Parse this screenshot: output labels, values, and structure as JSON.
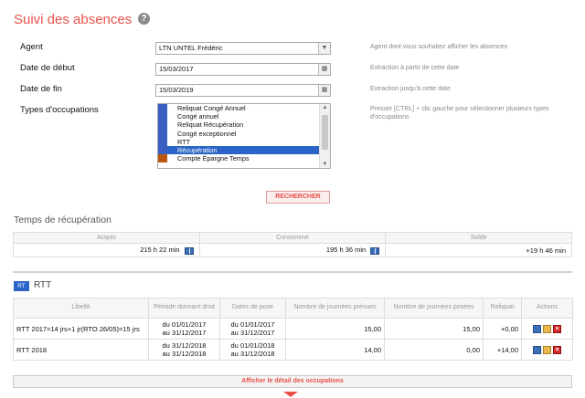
{
  "page": {
    "title": "Suivi des absences"
  },
  "form": {
    "agent": {
      "label": "Agent",
      "value": "LTN UNTEL Frédéric",
      "hint": "Agent dont vous souhaitez afficher les absences"
    },
    "start_date": {
      "label": "Date de début",
      "value": "15/03/2017",
      "hint": "Extraction à partir de cette date"
    },
    "end_date": {
      "label": "Date de fin",
      "value": "15/03/2019",
      "hint": "Extraction jusqu'à cette date"
    },
    "types": {
      "label": "Types d'occupations",
      "hint": "Presser [CTRL] + clic gauche pour sélectionner plusieurs types d'occupations",
      "options": [
        {
          "label": "Reliquat Congé Annuel",
          "color": "#3a5fc0",
          "selected": false
        },
        {
          "label": "Congé annuel",
          "color": "#3a5fc0",
          "selected": false
        },
        {
          "label": "Reliquat Récupération",
          "color": "#3a5fc0",
          "selected": false
        },
        {
          "label": "Congé exceptionnel",
          "color": "#3a5fc0",
          "selected": false
        },
        {
          "label": "RTT",
          "color": "#3a5fc0",
          "selected": false
        },
        {
          "label": "Récupération",
          "color": "#3a5fc0",
          "selected": true
        },
        {
          "label": "Compte Épargne Temps",
          "color": "#b8560e",
          "selected": false
        }
      ]
    },
    "search_label": "RECHERCHER"
  },
  "recup": {
    "title": "Temps de récupération",
    "headers": [
      "Acquis",
      "Consommé",
      "Solde"
    ],
    "values": [
      "215 h 22 min",
      "195 h 36 min",
      "+19 h 46 min"
    ]
  },
  "rtt": {
    "badge": "RT",
    "title": "RTT",
    "headers": [
      "Libellé",
      "Période donnant droit",
      "Dates de pose",
      "Nombre de journées prévues",
      "Nombre de journées posées",
      "Reliquat",
      "Actions"
    ],
    "rows": [
      {
        "libelle": "RTT 2017=14 jrs+1 jr(RTO 26/05)=15 jrs",
        "periode_du": "du 01/01/2017",
        "periode_au": "au 31/12/2017",
        "pose_du": "du 01/01/2017",
        "pose_au": "au 31/12/2017",
        "prevues": "15,00",
        "posees": "15,00",
        "reliquat": "+0,00"
      },
      {
        "libelle": "RTT 2018",
        "periode_du": "du 31/12/2018",
        "periode_au": "au 31/12/2018",
        "pose_du": "du 01/01/2018",
        "pose_au": "au 31/12/2018",
        "prevues": "14,00",
        "posees": "0,00",
        "reliquat": "+14,00"
      }
    ]
  },
  "detail_label": "Afficher le détail des occupations",
  "icons": {
    "help": "help-icon",
    "calendar": "calendar-icon",
    "dropdown": "chevron-down-icon",
    "book": "book-icon",
    "copy": "copy-icon",
    "delete": "delete-icon"
  }
}
